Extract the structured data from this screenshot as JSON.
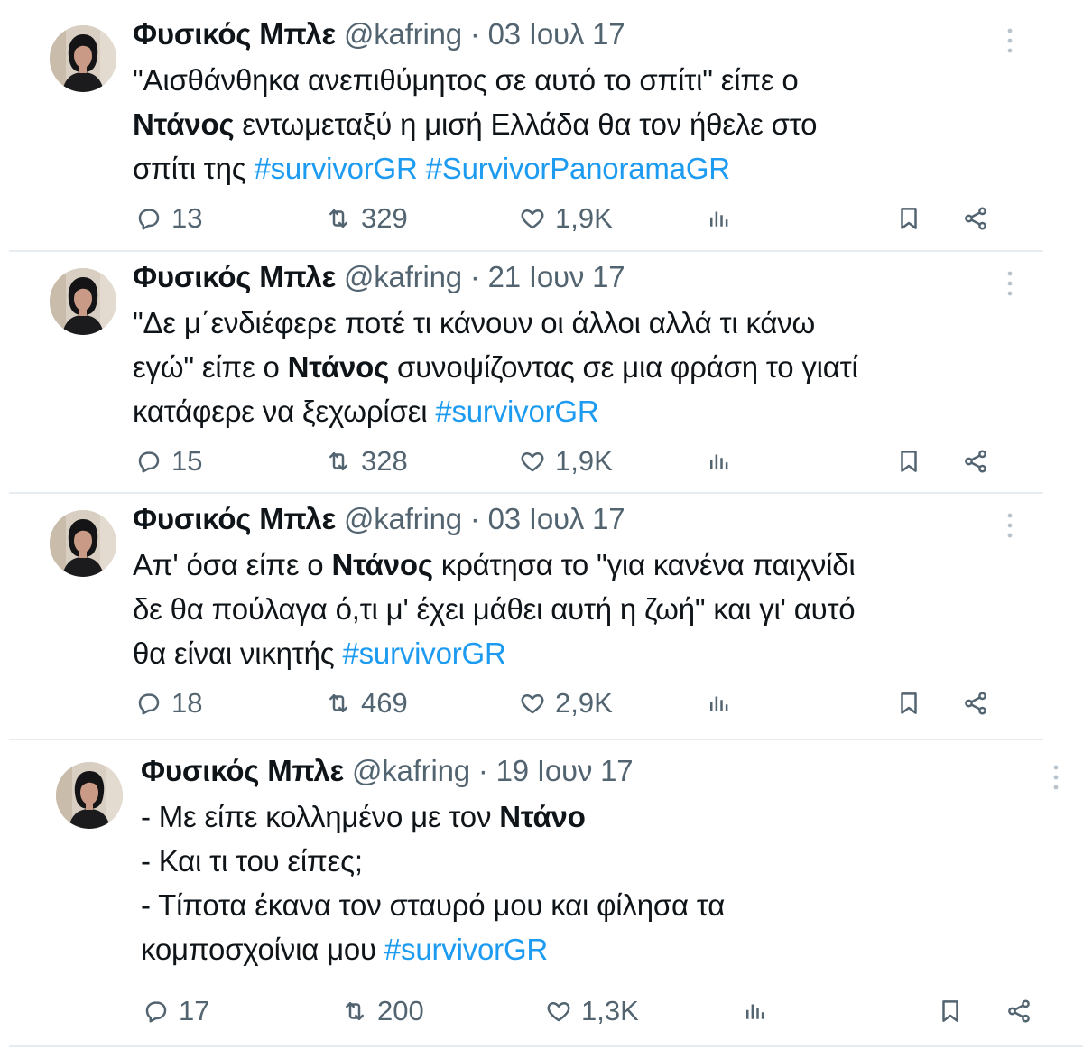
{
  "colors": {
    "text": "#0f1419",
    "muted": "#536471",
    "link": "#1d9bf0",
    "divider": "#e6ecf0"
  },
  "tweets": [
    {
      "name": "Φυσικός Μπλε",
      "handle": "@kafring",
      "sep": "·",
      "date": "03 Ιουλ 17",
      "lines": [
        [
          {
            "t": "\"Αισθάνθηκα ανεπιθύμητος σε αυτό το σπίτι\" είπε ο"
          }
        ],
        [
          {
            "t": "Ντάνος",
            "b": true
          },
          {
            "t": " εντωμεταξύ η μισή Ελλάδα θα τον ήθελε στο"
          }
        ],
        [
          {
            "t": "σπίτι της "
          },
          {
            "t": "#survivorGR",
            "h": true
          },
          {
            "t": " "
          },
          {
            "t": "#SurvivorPanoramaGR",
            "h": true
          }
        ]
      ],
      "replies": "13",
      "retweets": "329",
      "likes": "1,9K"
    },
    {
      "name": "Φυσικός Μπλε",
      "handle": "@kafring",
      "sep": "·",
      "date": "21 Ιουν 17",
      "lines": [
        [
          {
            "t": "\"Δε μ΄ενδιέφερε ποτέ τι κάνουν οι άλλοι αλλά τι κάνω"
          }
        ],
        [
          {
            "t": "εγώ\" είπε ο "
          },
          {
            "t": "Ντάνος",
            "b": true
          },
          {
            "t": " συνοψίζοντας σε μια φράση το γιατί"
          }
        ],
        [
          {
            "t": "κατάφερε να ξεχωρίσει "
          },
          {
            "t": "#survivorGR",
            "h": true
          }
        ]
      ],
      "replies": "15",
      "retweets": "328",
      "likes": "1,9K"
    },
    {
      "name": "Φυσικός Μπλε",
      "handle": "@kafring",
      "sep": "·",
      "date": "03 Ιουλ 17",
      "lines": [
        [
          {
            "t": "Απ' όσα είπε ο "
          },
          {
            "t": "Ντάνος",
            "b": true
          },
          {
            "t": " κράτησα το \"για κανένα παιχνίδι"
          }
        ],
        [
          {
            "t": "δε θα πούλαγα ό,τι μ' έχει μάθει αυτή η ζωή\" και γι' αυτό"
          }
        ],
        [
          {
            "t": "θα είναι νικητής "
          },
          {
            "t": "#survivorGR",
            "h": true
          }
        ]
      ],
      "replies": "18",
      "retweets": "469",
      "likes": "2,9K"
    },
    {
      "name": "Φυσικός Μπλε",
      "handle": "@kafring",
      "sep": "·",
      "date": "19 Ιουν 17",
      "lines": [
        [
          {
            "t": "- Με είπε κολλημένο με τον "
          },
          {
            "t": "Ντάνο",
            "b": true
          }
        ],
        [
          {
            "t": "- Και τι του είπες;"
          }
        ],
        [
          {
            "t": "- Τίποτα έκανα τον σταυρό μου και φίλησα τα"
          }
        ],
        [
          {
            "t": "κομποσχοίνια μου "
          },
          {
            "t": "#survivorGR",
            "h": true
          }
        ]
      ],
      "replies": "17",
      "retweets": "200",
      "likes": "1,3K"
    }
  ]
}
